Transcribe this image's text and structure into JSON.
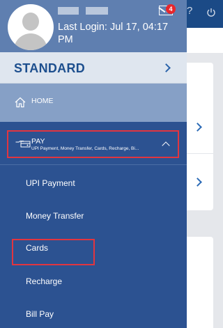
{
  "drawer": {
    "last_login": "Last Login: Jul 17, 04:17 PM",
    "mail_badge": "4",
    "plan_label": "STANDARD",
    "home_label": "HOME",
    "pay": {
      "title": "PAY",
      "subtitle": "UPI Payment, Money Transfer, Cards, Recharge, Bi..."
    },
    "pay_items": [
      {
        "label": "UPI Payment"
      },
      {
        "label": "Money Transfer"
      },
      {
        "label": "Cards"
      },
      {
        "label": "Recharge"
      },
      {
        "label": "Bill Pay"
      }
    ]
  },
  "background_app": {
    "topbar_icons": [
      "help-icon",
      "power-icon"
    ]
  },
  "colors": {
    "drawer_bg": "#2c5291",
    "header_bg": "#5f7fb0",
    "plan_bg": "#dfe6ef",
    "plan_text": "#1d4f8e",
    "home_bg": "#86a0c6",
    "badge": "#e8262b",
    "highlight": "#e2353f",
    "app_topbar": "#1b4a86"
  }
}
